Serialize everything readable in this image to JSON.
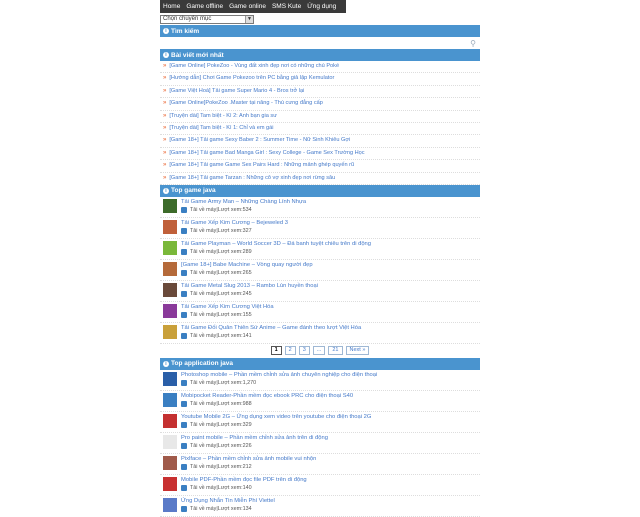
{
  "nav": [
    "Home",
    "Game offline",
    "Game online",
    "SMS Kute",
    "Ứng dụng"
  ],
  "category_select": "Chọn chuyên mục",
  "search_title": "Tìm kiếm",
  "latest_title": "Bài viết mới nhất",
  "latest_items": [
    "[Game Online] PokeZoo - Vùng đất xinh đẹp nơi có những chú Poké",
    "[Hướng dẫn] Chơi Game Pokezoo trên PC bằng giả lập Kemulator",
    "[Game Việt Hoá] Tải game Super Mario 4 - Bros trở lại",
    "[Game Online]PokeZoo .Master tại năng - Thú cưng đẳng cấp",
    "[Truyện dài] Tam biệt - Kì 2: Anh bạn gia sư",
    "[Truyện dài] Tam biệt - Kì 1: Chỉ và em gái",
    "[Game 18+] Tải game Sexy Baber 2 : Summer Time - Nữ Sinh Khiêu Gợi",
    "[Game 18+] Tải game Bad Manga Girl : Sexy College - Game Sex Trường Học",
    "[Game 18+] Tải game Game Sex Pairs Hard : Những mảnh ghép quyến rũ",
    "[Game 18+] Tải game Tarzan : Những cô vợ xinh đẹp nơi rừng sâu"
  ],
  "top_game_title": "Top game java",
  "download_label": "Tải về máy",
  "views_label": "Lượt xem",
  "top_games": [
    {
      "title": "Tải Game Army Man – Những Chàng Lính Nhựa",
      "views": "534",
      "color": "#3d6b2a"
    },
    {
      "title": "Tải Game Xếp Kim Cương – Bejeweled 3",
      "views": "327",
      "color": "#c0603a"
    },
    {
      "title": "Tải Game Playman – World Soccer 3D – Đá banh tuyệt chiêu trên di động",
      "views": "289",
      "color": "#7ab83a"
    },
    {
      "title": "[Game 18+] Babe Machine – Vòng quay người đẹp",
      "views": "265",
      "color": "#b56a3a"
    },
    {
      "title": "Tải Game Metal Slug 2013 – Rambo Lùn huyền thoại",
      "views": "245",
      "color": "#6a4a3a"
    },
    {
      "title": "Tải Game Xếp Kim Cương Việt Hóa",
      "views": "155",
      "color": "#8a3a9a"
    },
    {
      "title": "Tải Game Đối Quân Thiên Sứ Anime – Game đánh theo lượt Việt Hóa",
      "views": "141",
      "color": "#c9a03a"
    }
  ],
  "pager": [
    "1",
    "2",
    "3",
    "...",
    "21",
    "Next »"
  ],
  "top_app_title": "Top application java",
  "top_apps": [
    {
      "title": "Photoshop mobile – Phần mềm chỉnh sửa ảnh chuyên nghiệp cho điện thoại",
      "views": "1,270",
      "color": "#2a5fa8"
    },
    {
      "title": "Mobipocket Reader-Phần mềm đọc ebook PRC cho điện thoại S40",
      "views": "988",
      "color": "#3a7fc2"
    },
    {
      "title": "Youtube Mobile 2G – Ứng dụng xem video trên youtube cho điện thoại 2G",
      "views": "329",
      "color": "#c43030"
    },
    {
      "title": "Pro paint mobile – Phần mềm chỉnh sửa ảnh trên di động",
      "views": "226",
      "color": "#e8e8e8"
    },
    {
      "title": "Pixlface – Phần mềm chỉnh sửa ảnh mobile vui nhộn",
      "views": "212",
      "color": "#a05a4a"
    },
    {
      "title": "Mobile PDF-Phần mềm đọc file PDF trên di động",
      "views": "140",
      "color": "#c83030"
    },
    {
      "title": "Ứng Dụng Nhắn Tin Miễn Phí Viettel",
      "views": "134",
      "color": "#5a7ac8"
    }
  ],
  "colors": {
    "accent": "#4a94cf",
    "nav_bg": "#3a3a3a",
    "link": "#4479c9",
    "bullet": "#e8571e"
  }
}
